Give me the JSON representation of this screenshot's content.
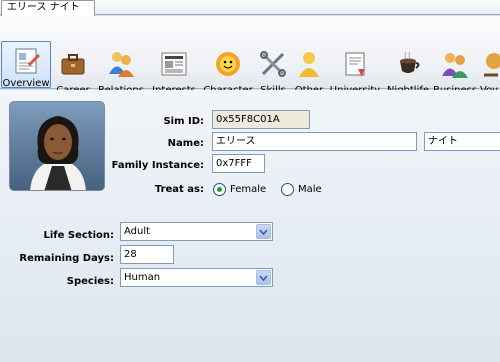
{
  "document_tab": "エリース ナイト",
  "toolbar": [
    {
      "label": "Overview",
      "icon": "overview-icon",
      "active": true
    },
    {
      "label": "Career",
      "icon": "career-icon",
      "active": false
    },
    {
      "label": "Relations",
      "icon": "relations-icon",
      "active": false
    },
    {
      "label": "Interests",
      "icon": "interests-icon",
      "active": false
    },
    {
      "label": "Character",
      "icon": "character-icon",
      "active": false
    },
    {
      "label": "Skills",
      "icon": "skills-icon",
      "active": false
    },
    {
      "label": "Other",
      "icon": "other-icon",
      "active": false
    },
    {
      "label": "University",
      "icon": "university-icon",
      "active": false
    },
    {
      "label": "Nightlife",
      "icon": "nightlife-icon",
      "active": false
    },
    {
      "label": "Business",
      "icon": "business-icon",
      "active": false
    },
    {
      "label": "Voy",
      "icon": "voyage-icon",
      "active": false
    }
  ],
  "form": {
    "sim_id_label": "Sim ID:",
    "sim_id_value": "0x55F8C01A",
    "name_label": "Name:",
    "first_name": "エリース",
    "last_name": "ナイト",
    "family_instance_label": "Family Instance:",
    "family_instance_value": "0x7FFF",
    "treat_as_label": "Treat as:",
    "female_label": "Female",
    "male_label": "Male",
    "treat_as_selected": "Female",
    "life_section_label": "Life Section:",
    "life_section_value": "Adult",
    "remaining_days_label": "Remaining Days:",
    "remaining_days_value": "28",
    "species_label": "Species:",
    "species_value": "Human"
  },
  "colors": {
    "selected_radio": "#21a121",
    "active_tab_border": "#5b86bd",
    "readonly_field": "#ede9dc"
  }
}
